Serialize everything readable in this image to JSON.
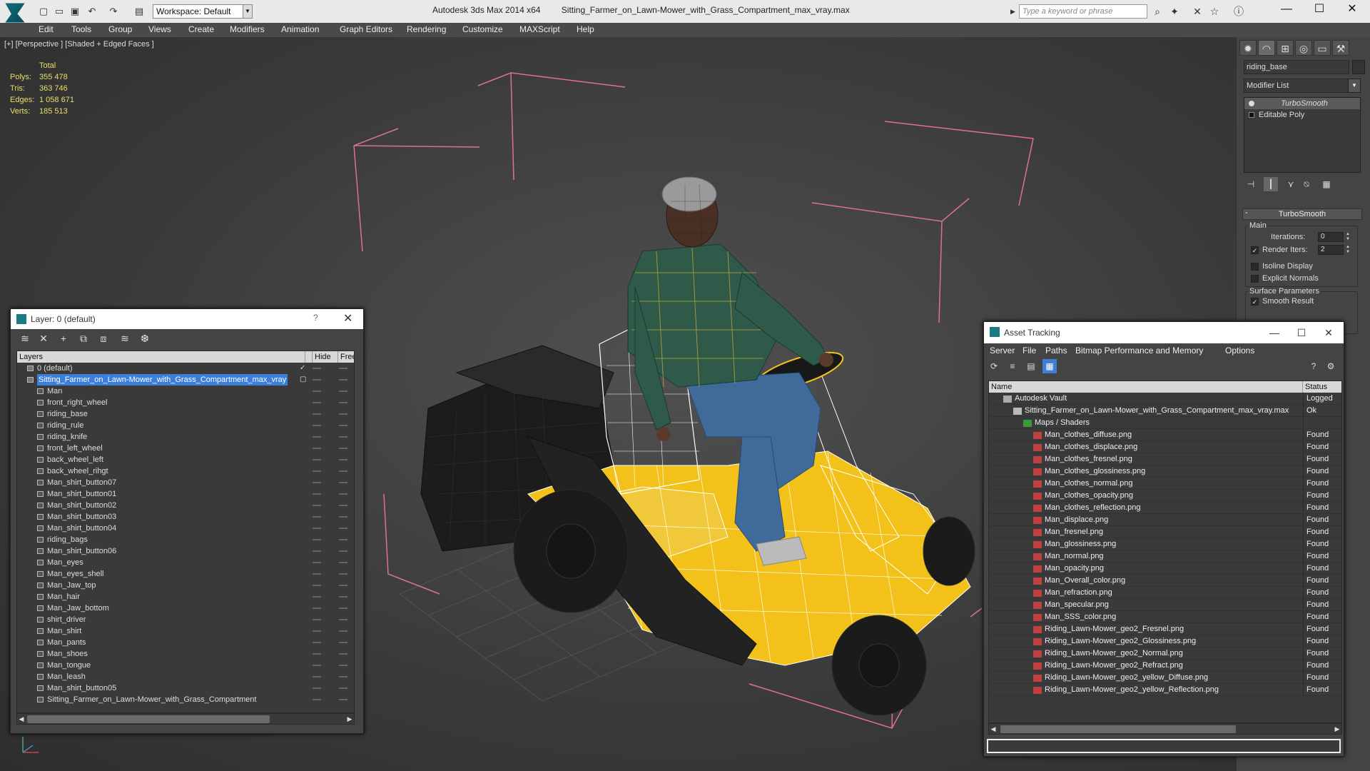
{
  "titlebar": {
    "workspace": "Workspace: Default",
    "app_title": "Autodesk 3ds Max  2014 x64",
    "file_title": "Sitting_Farmer_on_Lawn-Mower_with_Grass_Compartment_max_vray.max",
    "search_placeholder": "Type a keyword or phrase"
  },
  "menu": [
    "Edit",
    "Tools",
    "Group",
    "Views",
    "Create",
    "Modifiers",
    "Animation",
    "Graph Editors",
    "Rendering",
    "Customize",
    "MAXScript",
    "Help"
  ],
  "viewport": {
    "label": "[+] [Perspective ] [Shaded + Edged Faces ]",
    "stats": {
      "header": "Total",
      "rows": [
        {
          "label": "Polys:",
          "value": "355 478"
        },
        {
          "label": "Tris:",
          "value": "363 746"
        },
        {
          "label": "Edges:",
          "value": "1 058 671"
        },
        {
          "label": "Verts:",
          "value": "185 513"
        }
      ]
    }
  },
  "command_panel": {
    "object_name": "riding_base",
    "modifier_list": "Modifier List",
    "stack": [
      {
        "label": "TurboSmooth",
        "selected": true
      },
      {
        "label": "Editable Poly",
        "selected": false
      }
    ],
    "rollout_title": "TurboSmooth",
    "main_group": "Main",
    "iterations_label": "Iterations:",
    "iterations_value": "0",
    "render_iters_label": "Render Iters:",
    "render_iters_value": "2",
    "isoline_label": "Isoline Display",
    "explicit_normals_label": "Explicit Normals",
    "surface_group": "Surface Parameters",
    "smooth_result_label": "Smooth Result"
  },
  "layer_window": {
    "title": "Layer: 0 (default)",
    "help": "?",
    "columns": {
      "layers": "Layers",
      "hide": "Hide",
      "freeze": "Freeze"
    },
    "rows": [
      {
        "name": "0 (default)",
        "level": 0,
        "selected": false,
        "check": true
      },
      {
        "name": "Sitting_Farmer_on_Lawn-Mower_with_Grass_Compartment_max_vray",
        "level": 0,
        "selected": true,
        "check": false
      },
      {
        "name": "Man",
        "level": 1
      },
      {
        "name": "front_right_wheel",
        "level": 1
      },
      {
        "name": "riding_base",
        "level": 1
      },
      {
        "name": "riding_rule",
        "level": 1
      },
      {
        "name": "riding_knife",
        "level": 1
      },
      {
        "name": "front_left_wheel",
        "level": 1
      },
      {
        "name": "back_wheel_left",
        "level": 1
      },
      {
        "name": "back_wheel_rihgt",
        "level": 1
      },
      {
        "name": "Man_shirt_button07",
        "level": 1
      },
      {
        "name": "Man_shirt_button01",
        "level": 1
      },
      {
        "name": "Man_shirt_button02",
        "level": 1
      },
      {
        "name": "Man_shirt_button03",
        "level": 1
      },
      {
        "name": "Man_shirt_button04",
        "level": 1
      },
      {
        "name": "riding_bags",
        "level": 1
      },
      {
        "name": "Man_shirt_button06",
        "level": 1
      },
      {
        "name": "Man_eyes",
        "level": 1
      },
      {
        "name": "Man_eyes_shell",
        "level": 1
      },
      {
        "name": "Man_Jaw_top",
        "level": 1
      },
      {
        "name": "Man_hair",
        "level": 1
      },
      {
        "name": "Man_Jaw_bottom",
        "level": 1
      },
      {
        "name": "shirt_driver",
        "level": 1
      },
      {
        "name": "Man_shirt",
        "level": 1
      },
      {
        "name": "Man_pants",
        "level": 1
      },
      {
        "name": "Man_shoes",
        "level": 1
      },
      {
        "name": "Man_tongue",
        "level": 1
      },
      {
        "name": "Man_leash",
        "level": 1
      },
      {
        "name": "Man_shirt_button05",
        "level": 1
      },
      {
        "name": "Sitting_Farmer_on_Lawn-Mower_with_Grass_Compartment",
        "level": 1
      }
    ]
  },
  "asset_window": {
    "title": "Asset Tracking",
    "menu": [
      "Server",
      "File",
      "Paths",
      "Bitmap Performance and Memory",
      "Options"
    ],
    "columns": {
      "name": "Name",
      "status": "Status"
    },
    "rows": [
      {
        "name": "Autodesk Vault",
        "status": "Logged",
        "level": 0,
        "kind": "vault"
      },
      {
        "name": "Sitting_Farmer_on_Lawn-Mower_with_Grass_Compartment_max_vray.max",
        "status": "Ok",
        "level": 1,
        "kind": "max"
      },
      {
        "name": "Maps / Shaders",
        "status": "",
        "level": 2,
        "kind": "folder"
      },
      {
        "name": "Man_clothes_diffuse.png",
        "status": "Found",
        "level": 3,
        "kind": "png"
      },
      {
        "name": "Man_clothes_displace.png",
        "status": "Found",
        "level": 3,
        "kind": "png"
      },
      {
        "name": "Man_clothes_fresnel.png",
        "status": "Found",
        "level": 3,
        "kind": "png"
      },
      {
        "name": "Man_clothes_glossiness.png",
        "status": "Found",
        "level": 3,
        "kind": "png"
      },
      {
        "name": "Man_clothes_normal.png",
        "status": "Found",
        "level": 3,
        "kind": "png"
      },
      {
        "name": "Man_clothes_opacity.png",
        "status": "Found",
        "level": 3,
        "kind": "png"
      },
      {
        "name": "Man_clothes_reflection.png",
        "status": "Found",
        "level": 3,
        "kind": "png"
      },
      {
        "name": "Man_displace.png",
        "status": "Found",
        "level": 3,
        "kind": "png"
      },
      {
        "name": "Man_fresnel.png",
        "status": "Found",
        "level": 3,
        "kind": "png"
      },
      {
        "name": "Man_glossiness.png",
        "status": "Found",
        "level": 3,
        "kind": "png"
      },
      {
        "name": "Man_normal.png",
        "status": "Found",
        "level": 3,
        "kind": "png"
      },
      {
        "name": "Man_opacity.png",
        "status": "Found",
        "level": 3,
        "kind": "png"
      },
      {
        "name": "Man_Overall_color.png",
        "status": "Found",
        "level": 3,
        "kind": "png"
      },
      {
        "name": "Man_refraction.png",
        "status": "Found",
        "level": 3,
        "kind": "png"
      },
      {
        "name": "Man_specular.png",
        "status": "Found",
        "level": 3,
        "kind": "png"
      },
      {
        "name": "Man_SSS_color.png",
        "status": "Found",
        "level": 3,
        "kind": "png"
      },
      {
        "name": "Riding_Lawn-Mower_geo2_Fresnel.png",
        "status": "Found",
        "level": 3,
        "kind": "png"
      },
      {
        "name": "Riding_Lawn-Mower_geo2_Glossiness.png",
        "status": "Found",
        "level": 3,
        "kind": "png"
      },
      {
        "name": "Riding_Lawn-Mower_geo2_Normal.png",
        "status": "Found",
        "level": 3,
        "kind": "png"
      },
      {
        "name": "Riding_Lawn-Mower_geo2_Refract.png",
        "status": "Found",
        "level": 3,
        "kind": "png"
      },
      {
        "name": "Riding_Lawn-Mower_geo2_yellow_Diffuse.png",
        "status": "Found",
        "level": 3,
        "kind": "png"
      },
      {
        "name": "Riding_Lawn-Mower_geo2_yellow_Reflection.png",
        "status": "Found",
        "level": 3,
        "kind": "png"
      }
    ]
  },
  "colors": {
    "accent": "#3d7ed8",
    "stats_text": "#e6e066",
    "bbox": "#e0708f",
    "mower_yellow": "#f2c21a",
    "teal": "#1a7a86"
  }
}
